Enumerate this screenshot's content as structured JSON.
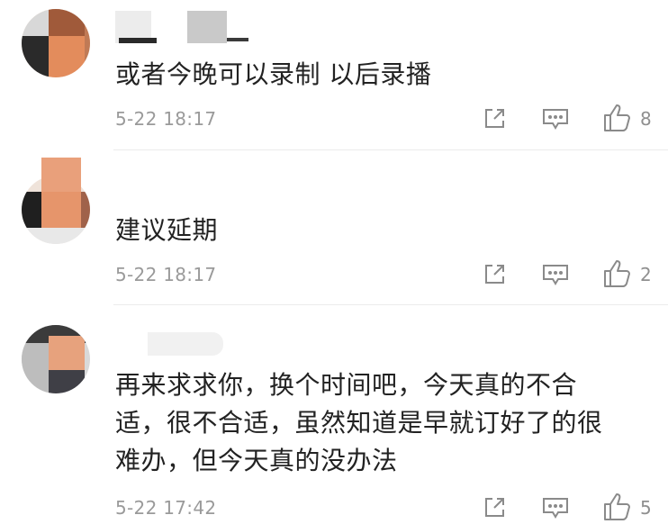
{
  "comments": [
    {
      "text": "或者今晚可以录制 以后录播",
      "time": "5-22 18:17",
      "likes": "8",
      "share_icon": "share-icon",
      "reply_icon": "reply-icon",
      "like_icon": "thumbs-up-icon"
    },
    {
      "text": "建议延期",
      "time": "5-22 18:17",
      "likes": "2",
      "share_icon": "share-icon",
      "reply_icon": "reply-icon",
      "like_icon": "thumbs-up-icon"
    },
    {
      "text": "再来求求你，换个时间吧，今天真的不合\n适，很不合适，虽然知道是早就订好了的很\n难办，但今天真的没办法",
      "time": "5-22 17:42",
      "likes": "5",
      "share_icon": "share-icon",
      "reply_icon": "reply-icon",
      "like_icon": "thumbs-up-icon"
    }
  ],
  "colors": {
    "text": "#222222",
    "meta": "#9a9a9a",
    "divider": "#ebebeb",
    "icon": "#8a8a8a"
  }
}
